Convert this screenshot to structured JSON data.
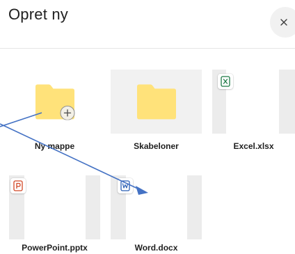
{
  "dialog": {
    "title": "Opret ny",
    "close_icon": "close-icon"
  },
  "tiles": [
    {
      "label": "Ny mappe",
      "kind": "folder",
      "icon": "folder-plus-icon"
    },
    {
      "label": "Skabeloner",
      "kind": "folder",
      "icon": "folder-icon"
    },
    {
      "label": "Excel.xlsx",
      "kind": "document",
      "icon": "excel-icon",
      "badge_letter": "x"
    },
    {
      "label": "PowerPoint.pptx",
      "kind": "document",
      "icon": "powerpoint-icon",
      "badge_letter": "P"
    },
    {
      "label": "Word.docx",
      "kind": "document",
      "icon": "word-icon",
      "badge_letter": "W"
    }
  ],
  "colors": {
    "folder": "#FFE27A",
    "excel": "#1D7A45",
    "powerpoint": "#D24726",
    "word": "#2B5FB4",
    "annotation_arrow": "#4472C4",
    "thumb_background": "#ECECEC"
  }
}
